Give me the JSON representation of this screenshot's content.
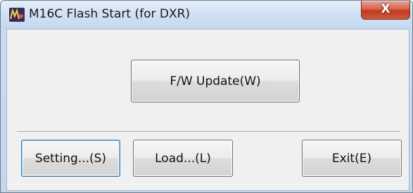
{
  "window": {
    "title": "M16C Flash Start (for DXR)",
    "close_label": "X",
    "app_icon": "m16c-app-icon"
  },
  "buttons": {
    "fw_update": "F/W Update(W)",
    "setting": "Setting...(S)",
    "load": "Load...(L)",
    "exit": "Exit(E)"
  },
  "colors": {
    "titlebar": "#c9dcf0",
    "close_button": "#c9442a",
    "face": "#f0f0f0",
    "default_button_border": "#3c7fb1"
  }
}
